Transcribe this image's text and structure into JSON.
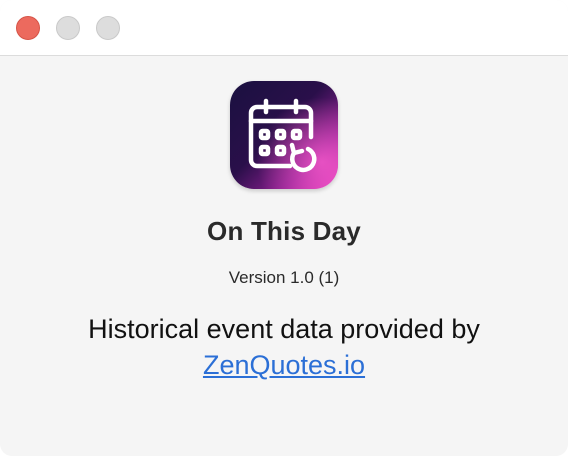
{
  "window": {
    "controls": {
      "close": "close",
      "minimize": "minimize",
      "zoom": "zoom"
    }
  },
  "app": {
    "icon": "calendar-refresh-icon",
    "name": "On This Day",
    "version": "Version 1.0 (1)"
  },
  "credit": {
    "text": "Historical event data provided by",
    "link_text": "ZenQuotes.io"
  },
  "colors": {
    "close_button": "#ec6a5e",
    "link": "#2b6fd6",
    "icon_gradient_start": "#1a1140",
    "icon_gradient_end": "#e63fbf"
  }
}
